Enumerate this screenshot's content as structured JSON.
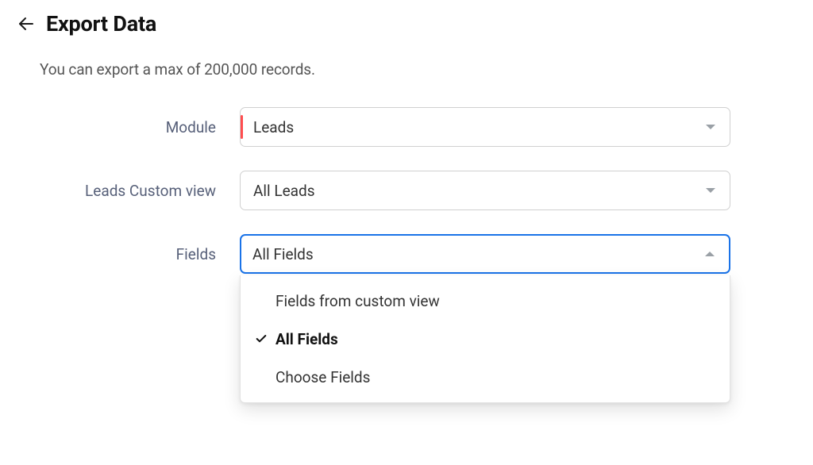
{
  "page": {
    "title": "Export Data",
    "intro": "You can export a max of 200,000 records."
  },
  "labels": {
    "module": "Module",
    "customView": "Leads Custom view",
    "fields": "Fields"
  },
  "selects": {
    "module": {
      "value": "Leads"
    },
    "customView": {
      "value": "All Leads"
    },
    "fields": {
      "value": "All Fields",
      "open": true,
      "options": [
        {
          "label": "Fields from custom view",
          "selected": false
        },
        {
          "label": "All Fields",
          "selected": true
        },
        {
          "label": "Choose Fields",
          "selected": false
        }
      ]
    }
  }
}
